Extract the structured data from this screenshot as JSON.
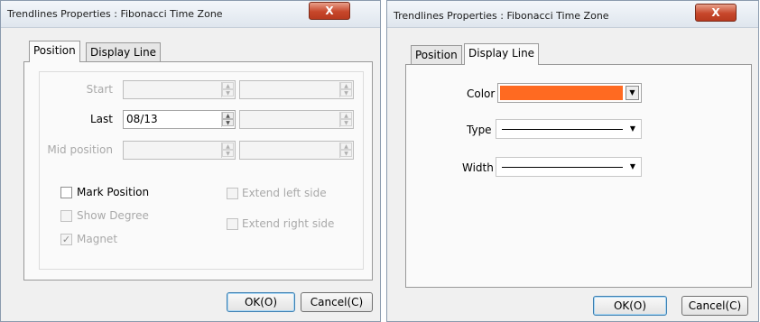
{
  "left_dialog": {
    "title": "Trendlines Properties : Fibonacci Time Zone",
    "close_glyph": "X",
    "tabs": [
      {
        "label": "Position",
        "active": true
      },
      {
        "label": "Display Line",
        "active": false
      }
    ],
    "fields": {
      "start": {
        "label": "Start",
        "value": "",
        "enabled": false
      },
      "last": {
        "label": "Last",
        "value": "08/13",
        "enabled": true
      },
      "mid": {
        "label": "Mid position",
        "value": "",
        "enabled": false
      }
    },
    "checkboxes": {
      "mark_position": {
        "label": "Mark Position",
        "checked": false,
        "enabled": true
      },
      "show_degree": {
        "label": "Show Degree",
        "checked": false,
        "enabled": false
      },
      "magnet": {
        "label": "Magnet",
        "checked": true,
        "enabled": false
      },
      "extend_left": {
        "label": "Extend left side",
        "checked": false,
        "enabled": false
      },
      "extend_right": {
        "label": "Extend right side",
        "checked": false,
        "enabled": false
      }
    },
    "check_glyph": "✓",
    "buttons": {
      "ok": "OK(O)",
      "cancel": "Cancel(C)"
    }
  },
  "right_dialog": {
    "title": "Trendlines Properties : Fibonacci Time Zone",
    "close_glyph": "X",
    "tabs": [
      {
        "label": "Position",
        "active": false
      },
      {
        "label": "Display Line",
        "active": true
      }
    ],
    "color": {
      "label": "Color",
      "value": "#ff6a21"
    },
    "type": {
      "label": "Type"
    },
    "width": {
      "label": "Width"
    },
    "buttons": {
      "ok": "OK(O)",
      "cancel": "Cancel(C)"
    }
  },
  "glyphs": {
    "up": "▲",
    "down": "▼",
    "combo_down": "▼"
  }
}
